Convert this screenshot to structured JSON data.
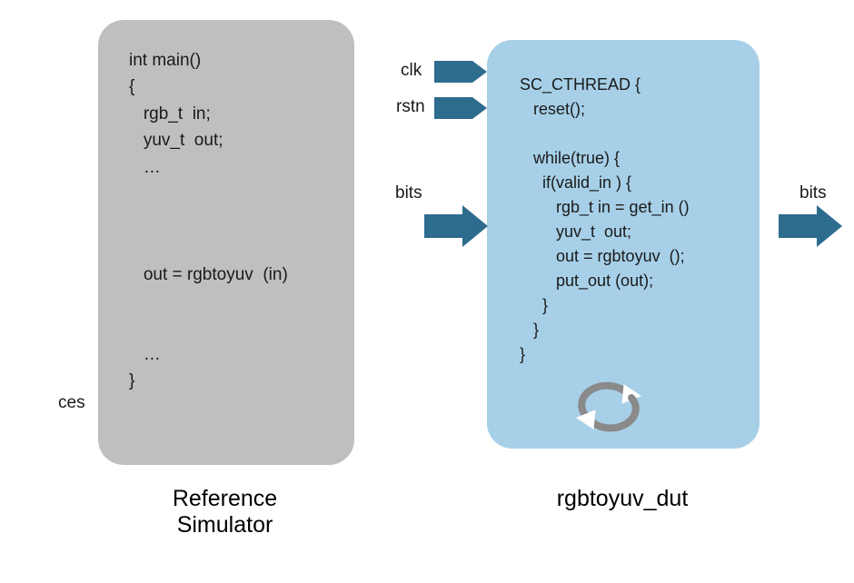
{
  "ref_simulator": {
    "label": "Reference Simulator",
    "side_label": "ces",
    "code": "int main()\n{\n   rgb_t  in;\n   yuv_t  out;\n   …\n\n\n\n   out = rgbtoyuv  (in)\n\n\n   …\n}"
  },
  "dut": {
    "label": "rgbtoyuv_dut",
    "signals": {
      "clk": "clk",
      "rstn": "rstn",
      "bits_in": "bits",
      "bits_out": "bits"
    },
    "code": "SC_CTHREAD {\n   reset();\n\n   while(true) {\n     if(valid_in ) {\n        rgb_t in = get_in ()\n        yuv_t  out;\n        out = rgbtoyuv  ();\n        put_out (out);\n     }\n   }\n}"
  },
  "colors": {
    "arrow": "#2e6c8e",
    "cycle_gray": "#8a8a8a",
    "cycle_white": "#ffffff"
  }
}
